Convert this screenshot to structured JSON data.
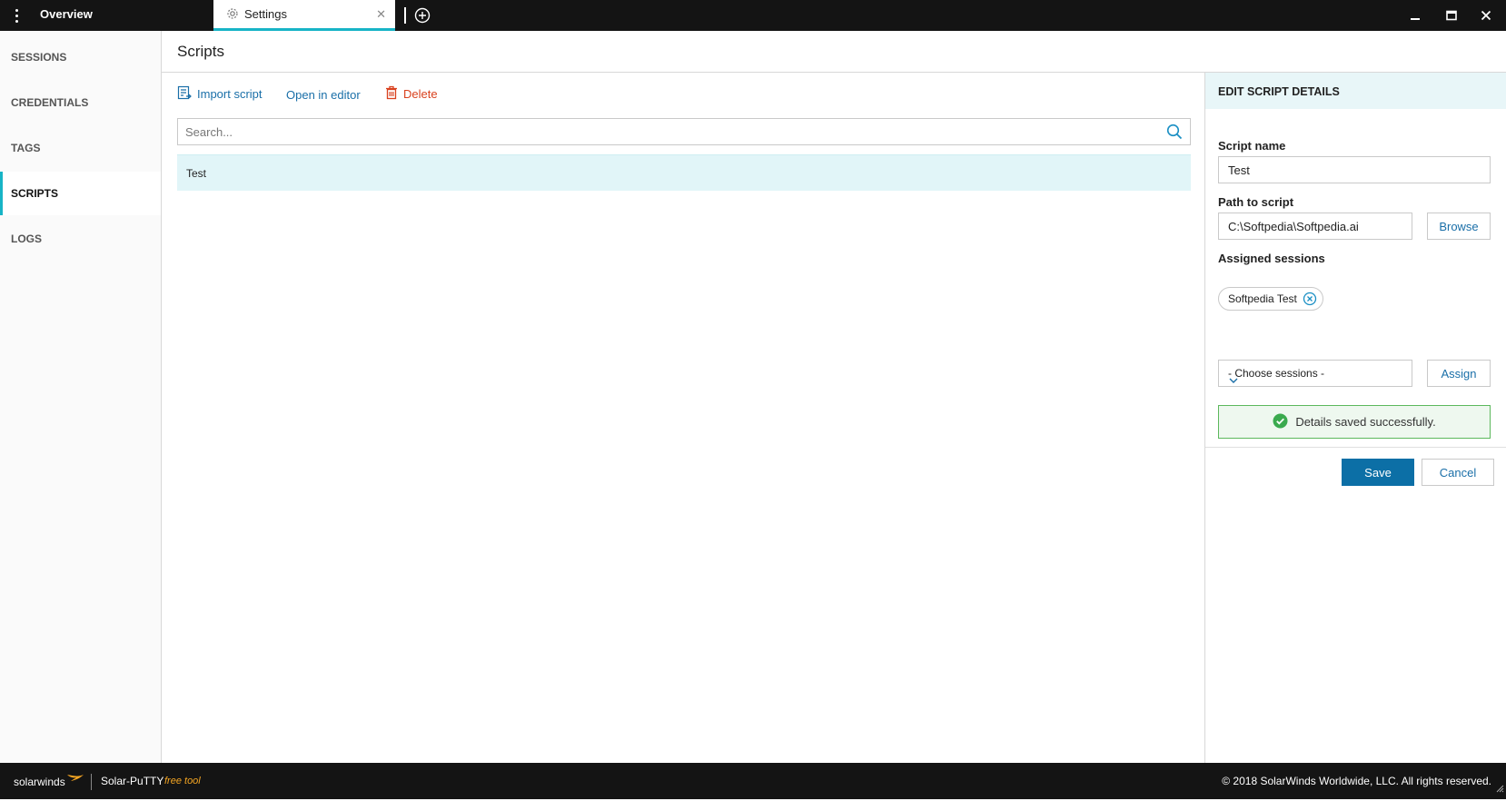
{
  "titlebar": {
    "tabs": [
      {
        "label": "Overview"
      },
      {
        "label": "Settings"
      }
    ],
    "icons": [
      "kebab-menu-icon",
      "gear-icon",
      "close-icon",
      "add-tab-icon",
      "minimize-icon",
      "maximize-icon",
      "close-window-icon"
    ]
  },
  "sidebar": {
    "items": [
      {
        "label": "SESSIONS"
      },
      {
        "label": "CREDENTIALS"
      },
      {
        "label": "TAGS"
      },
      {
        "label": "SCRIPTS",
        "active": true
      },
      {
        "label": "LOGS"
      }
    ]
  },
  "main": {
    "title": "Scripts",
    "toolbar": {
      "import_label": "Import script",
      "open_label": "Open in editor",
      "delete_label": "Delete"
    },
    "search": {
      "placeholder": "Search...",
      "value": ""
    },
    "scripts": [
      {
        "name": "Test",
        "selected": true
      }
    ]
  },
  "details": {
    "header": "EDIT SCRIPT DETAILS",
    "script_name_label": "Script name",
    "script_name_value": "Test",
    "path_label": "Path to script",
    "path_value": "C:\\Softpedia\\Softpedia.ai",
    "browse_label": "Browse",
    "assigned_label": "Assigned sessions",
    "assigned_sessions": [
      "Softpedia Test"
    ],
    "choose_sessions": "- Choose sessions -",
    "assign_label": "Assign",
    "success_message": "Details saved successfully.",
    "save_label": "Save",
    "cancel_label": "Cancel"
  },
  "footer": {
    "brand": "solarwinds",
    "product": "Solar-PuTTY",
    "product_tag": "free tool",
    "copyright": "© 2018 SolarWinds Worldwide, LLC. All rights reserved."
  },
  "colors": {
    "accent": "#17b4c6",
    "link": "#1a6fa8",
    "danger": "#d9411e",
    "primary_button": "#0c6fa6",
    "success_border": "#5cb85c",
    "titlebar_bg": "#141414"
  }
}
